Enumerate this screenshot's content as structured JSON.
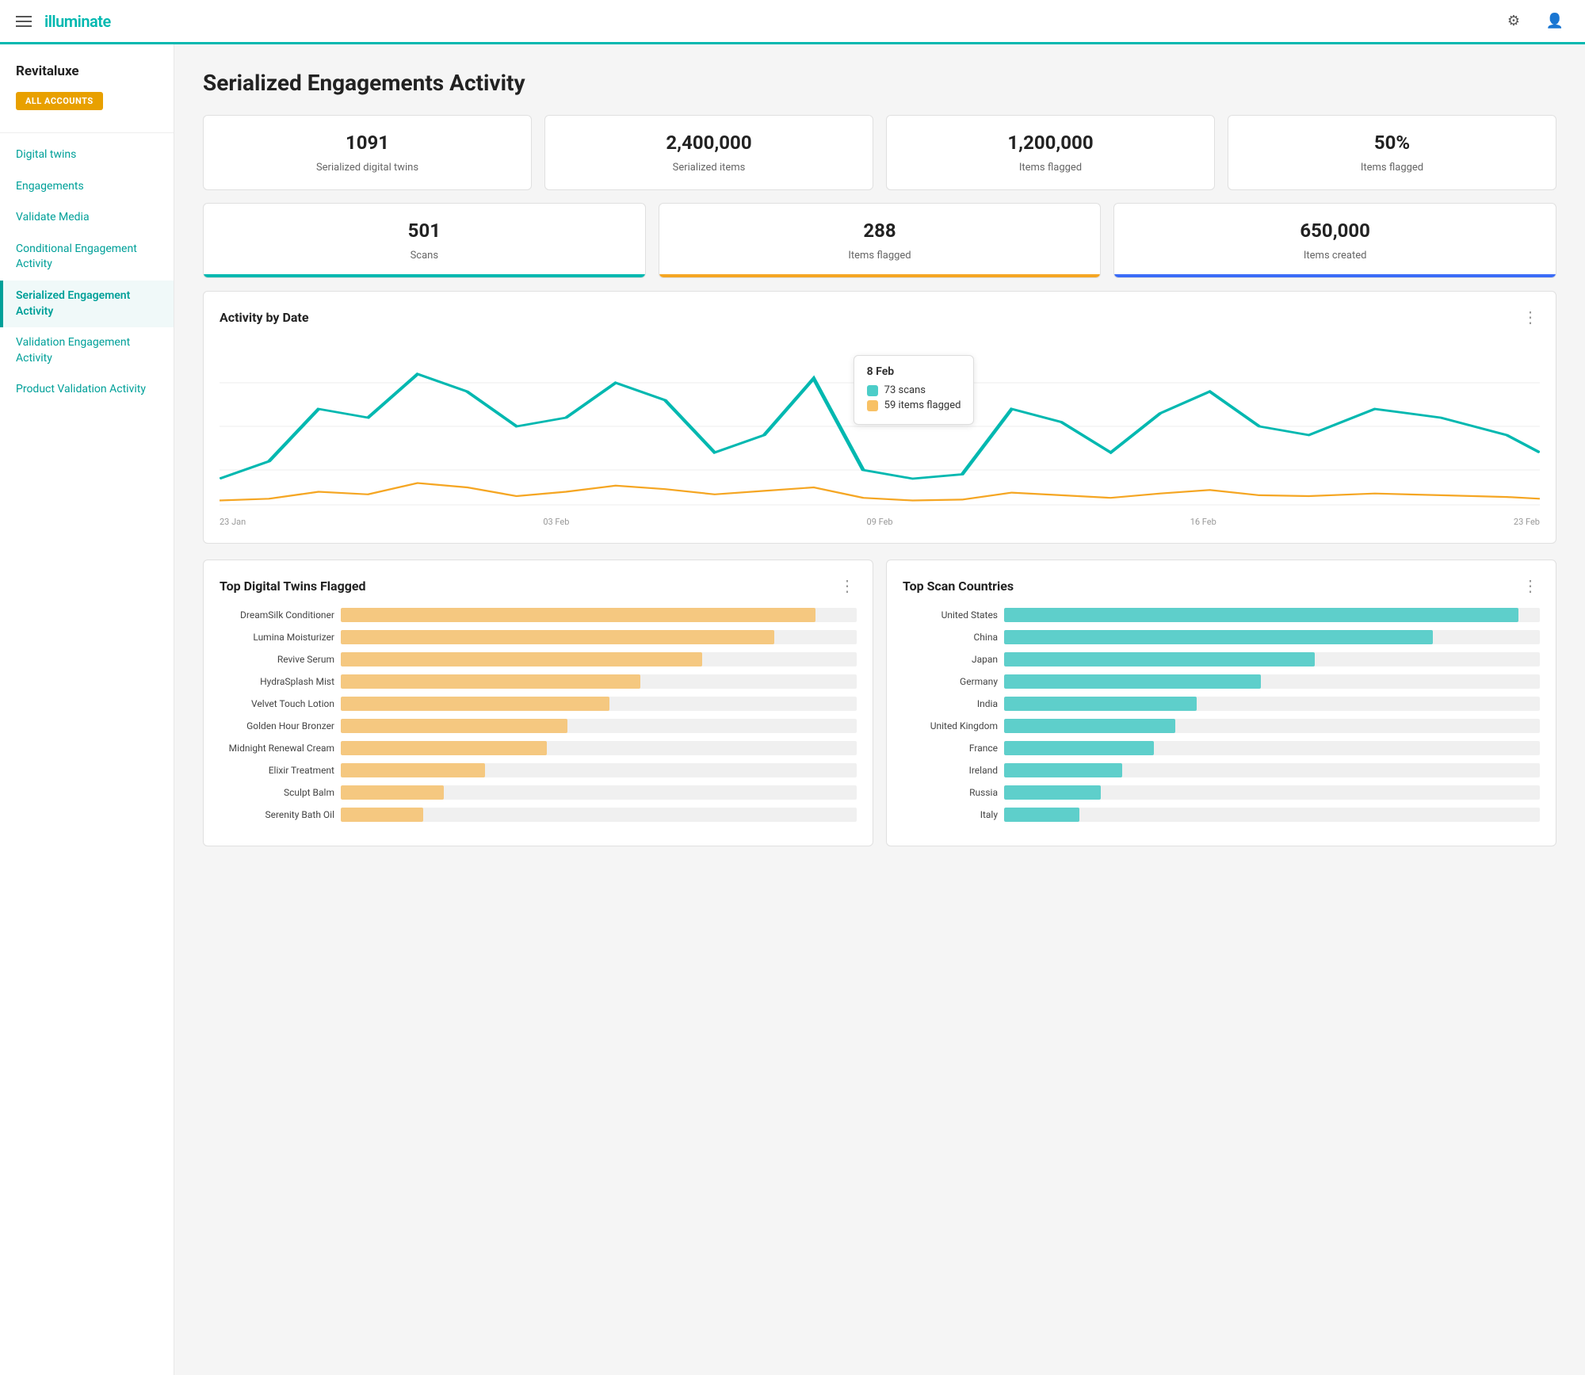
{
  "header": {
    "logo": "illuminate",
    "gear_icon": "⚙",
    "user_icon": "👤"
  },
  "sidebar": {
    "brand": "Revitaluxe",
    "all_accounts_label": "ALL ACCOUNTS",
    "nav_items": [
      {
        "label": "Digital twins",
        "active": false
      },
      {
        "label": "Engagements",
        "active": false
      },
      {
        "label": "Validate Media",
        "active": false
      },
      {
        "label": "Conditional Engagement Activity",
        "active": false
      },
      {
        "label": "Serialized Engagement Activity",
        "active": true
      },
      {
        "label": "Validation Engagement Activity",
        "active": false
      },
      {
        "label": "Product Validation Activity",
        "active": false
      }
    ]
  },
  "main": {
    "page_title": "Serialized Engagements Activity",
    "stats_row1": [
      {
        "value": "1091",
        "label": "Serialized digital twins",
        "bar": "none"
      },
      {
        "value": "2,400,000",
        "label": "Serialized items",
        "bar": "none"
      },
      {
        "value": "1,200,000",
        "label": "Items flagged",
        "bar": "none"
      },
      {
        "value": "50%",
        "label": "Items flagged",
        "bar": "none"
      }
    ],
    "stats_row2": [
      {
        "value": "501",
        "label": "Scans",
        "bar": "teal"
      },
      {
        "value": "288",
        "label": "Items flagged",
        "bar": "orange"
      },
      {
        "value": "650,000",
        "label": "Items created",
        "bar": "blue"
      }
    ],
    "activity_chart": {
      "title": "Activity by Date",
      "tooltip": {
        "date": "8 Feb",
        "scans_label": "73 scans",
        "flagged_label": "59 items flagged"
      },
      "x_labels": [
        "23 Jan",
        "03 Feb",
        "09 Feb",
        "16 Feb",
        "23 Feb"
      ]
    },
    "top_twins": {
      "title": "Top Digital Twins Flagged",
      "items": [
        {
          "label": "DreamSilk Conditioner",
          "pct": 92
        },
        {
          "label": "Lumina Moisturizer",
          "pct": 84
        },
        {
          "label": "Revive Serum",
          "pct": 70
        },
        {
          "label": "HydraSplash Mist",
          "pct": 58
        },
        {
          "label": "Velvet Touch Lotion",
          "pct": 52
        },
        {
          "label": "Golden Hour Bronzer",
          "pct": 44
        },
        {
          "label": "Midnight Renewal Cream",
          "pct": 40
        },
        {
          "label": "Elixir Treatment",
          "pct": 28
        },
        {
          "label": "Sculpt Balm",
          "pct": 20
        },
        {
          "label": "Serenity Bath Oil",
          "pct": 16
        }
      ]
    },
    "top_countries": {
      "title": "Top Scan Countries",
      "items": [
        {
          "label": "United States",
          "pct": 96
        },
        {
          "label": "China",
          "pct": 80
        },
        {
          "label": "Japan",
          "pct": 58
        },
        {
          "label": "Germany",
          "pct": 48
        },
        {
          "label": "India",
          "pct": 36
        },
        {
          "label": "United Kingdom",
          "pct": 32
        },
        {
          "label": "France",
          "pct": 28
        },
        {
          "label": "Ireland",
          "pct": 22
        },
        {
          "label": "Russia",
          "pct": 18
        },
        {
          "label": "Italy",
          "pct": 14
        }
      ]
    }
  }
}
